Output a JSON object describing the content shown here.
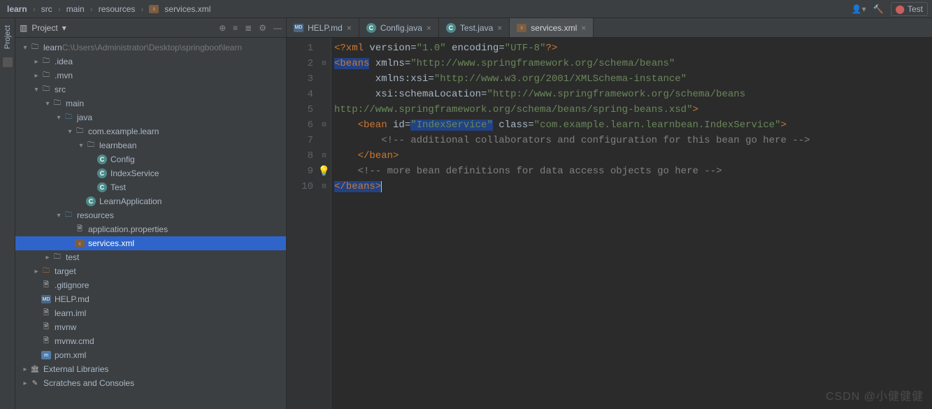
{
  "breadcrumb": [
    "learn",
    "src",
    "main",
    "resources",
    "services.xml"
  ],
  "top_right": {
    "test_label": "Test"
  },
  "project_panel": {
    "title": "Project"
  },
  "tree": [
    {
      "d": 0,
      "a": "▾",
      "ic": "folder",
      "label": "learn",
      "extra": "C:\\Users\\Administrator\\Desktop\\springboot\\learn"
    },
    {
      "d": 1,
      "a": "▸",
      "ic": "folder",
      "label": ".idea"
    },
    {
      "d": 1,
      "a": "▸",
      "ic": "folder",
      "label": ".mvn"
    },
    {
      "d": 1,
      "a": "▾",
      "ic": "folder",
      "label": "src"
    },
    {
      "d": 2,
      "a": "▾",
      "ic": "folder",
      "label": "main"
    },
    {
      "d": 3,
      "a": "▾",
      "ic": "folder-blue",
      "label": "java"
    },
    {
      "d": 4,
      "a": "▾",
      "ic": "folder",
      "label": "com.example.learn"
    },
    {
      "d": 5,
      "a": "▾",
      "ic": "folder",
      "label": "learnbean"
    },
    {
      "d": 6,
      "a": "",
      "ic": "class",
      "label": "Config"
    },
    {
      "d": 6,
      "a": "",
      "ic": "class",
      "label": "IndexService"
    },
    {
      "d": 6,
      "a": "",
      "ic": "class",
      "label": "Test"
    },
    {
      "d": 5,
      "a": "",
      "ic": "class",
      "label": "LearnApplication"
    },
    {
      "d": 3,
      "a": "▾",
      "ic": "folder-blue",
      "label": "resources"
    },
    {
      "d": 4,
      "a": "",
      "ic": "file",
      "label": "application.properties"
    },
    {
      "d": 4,
      "a": "",
      "ic": "xml",
      "label": "services.xml",
      "selected": true
    },
    {
      "d": 2,
      "a": "▸",
      "ic": "folder",
      "label": "test"
    },
    {
      "d": 1,
      "a": "▸",
      "ic": "folder-orange",
      "label": "target"
    },
    {
      "d": 1,
      "a": "",
      "ic": "file",
      "label": ".gitignore"
    },
    {
      "d": 1,
      "a": "",
      "ic": "md",
      "label": "HELP.md"
    },
    {
      "d": 1,
      "a": "",
      "ic": "file",
      "label": "learn.iml"
    },
    {
      "d": 1,
      "a": "",
      "ic": "file",
      "label": "mvnw"
    },
    {
      "d": 1,
      "a": "",
      "ic": "file",
      "label": "mvnw.cmd"
    },
    {
      "d": 1,
      "a": "",
      "ic": "xml-m",
      "label": "pom.xml"
    },
    {
      "d": 0,
      "a": "▸",
      "ic": "lib",
      "label": "External Libraries"
    },
    {
      "d": 0,
      "a": "▸",
      "ic": "scratch",
      "label": "Scratches and Consoles"
    }
  ],
  "tabs": [
    {
      "icon": "md",
      "label": "HELP.md"
    },
    {
      "icon": "class",
      "label": "Config.java"
    },
    {
      "icon": "class",
      "label": "Test.java"
    },
    {
      "icon": "xml",
      "label": "services.xml",
      "active": true
    }
  ],
  "code": {
    "lines": [
      1,
      2,
      3,
      4,
      5,
      6,
      7,
      8,
      9,
      10
    ],
    "content": {
      "l1": {
        "p1": "<?xml",
        "p2": " version=",
        "v1": "\"1.0\"",
        "p3": " encoding=",
        "v2": "\"UTF-8\"",
        "p4": "?>"
      },
      "l2": {
        "p1": "<beans",
        "p2": " xmlns=",
        "v1": "\"http://www.springframework.org/schema/beans\""
      },
      "l3": {
        "p1": "       xmlns:xsi=",
        "v1": "\"http://www.w3.org/2001/XMLSchema-instance\""
      },
      "l4": {
        "p1": "       xsi:schemaLocation=",
        "v1": "\"http://www.springframework.org/schema/beans"
      },
      "l5": {
        "v1": "http://www.springframework.org/schema/beans/spring-beans.xsd\"",
        "p1": ">"
      },
      "l6": {
        "p1": "    <bean",
        "p2": " id=",
        "v1": "\"IndexService\"",
        "p3": " class=",
        "v2": "\"com.example.learn.learnbean.IndexService\"",
        "p4": ">"
      },
      "l7": {
        "c1": "        <!-- additional collaborators and configuration for this bean go here -->"
      },
      "l8": {
        "p1": "    </bean>"
      },
      "l9": {
        "c1": "    <!-- more bean definitions for data access objects go here -->"
      },
      "l10": {
        "p1": "</beans>"
      }
    }
  },
  "side": {
    "project": "Project"
  },
  "watermark": "CSDN @小健健健"
}
